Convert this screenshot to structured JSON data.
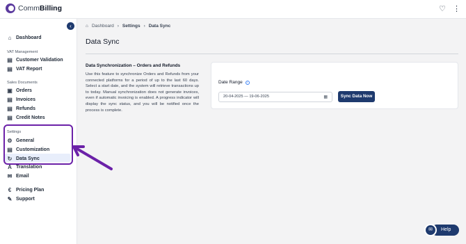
{
  "app": {
    "brand_light": "Comm",
    "brand_bold": "Billing"
  },
  "topbar": {
    "favorite_icon": "heart-icon",
    "menu_icon": "kebab-menu-icon"
  },
  "sidebar": {
    "dashboard": "Dashboard",
    "vat_section": "VAT Management",
    "customer_validation": "Customer Validation",
    "vat_report": "VAT Report",
    "sales_section": "Sales Documents",
    "orders": "Orders",
    "invoices": "Invoices",
    "refunds": "Refunds",
    "credit_notes": "Credit Notes",
    "settings_section": "Settings",
    "general": "General",
    "customization": "Customization",
    "data_sync": "Data Sync",
    "translation": "Translation",
    "email": "Email",
    "pricing_plan": "Pricing Plan",
    "support": "Support"
  },
  "breadcrumb": {
    "home": "Dashboard",
    "settings": "Settings",
    "current": "Data Sync"
  },
  "page": {
    "title": "Data Sync"
  },
  "description": {
    "title": "Data Synchronization – Orders and Refunds",
    "body": "Use this feature to synchronize Orders and Refunds from your connected platforms for a period of up to the last 60 days. Select a start date, and the system will retrieve transactions up to today. Manual synchronization does not generate invoices, even if automatic invoicing is enabled. A progress indicator will display the sync status, and you will be notified once the process is complete."
  },
  "form": {
    "date_range_label": "Date Range",
    "date_range_value": "20-04-2025 — 19-06-2025",
    "sync_button": "Sync Data Now"
  },
  "help": {
    "label": "Help"
  },
  "colors": {
    "primary": "#1e3a6e",
    "annotation": "#6b21a8",
    "active_bg": "#e8eefb"
  }
}
